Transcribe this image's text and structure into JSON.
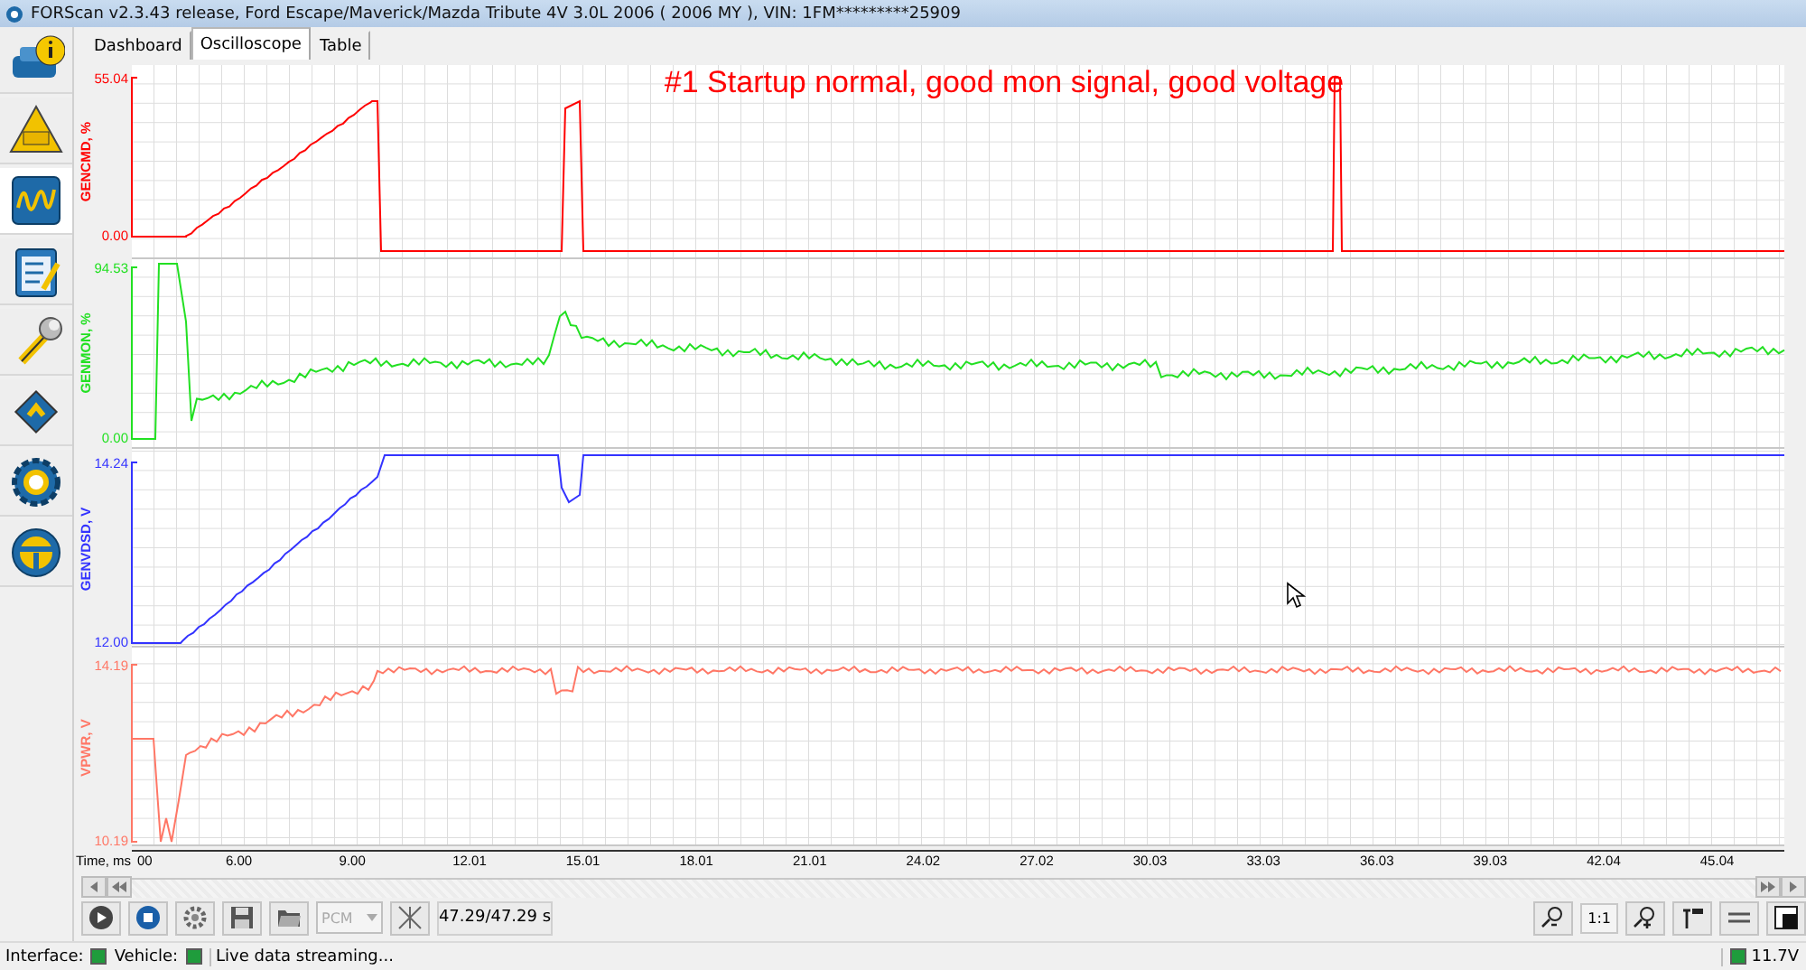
{
  "window": {
    "title": "FORScan v2.3.43 release, Ford Escape/Maverick/Mazda Tribute 4V 3.0L 2006 ( 2006 MY ), VIN: 1FM*********25909"
  },
  "sidebar": {
    "items": [
      {
        "selected": false
      },
      {
        "selected": false
      },
      {
        "selected": true
      },
      {
        "selected": false
      },
      {
        "selected": false
      },
      {
        "selected": false
      },
      {
        "selected": false
      },
      {
        "selected": false
      }
    ]
  },
  "tabs": [
    {
      "label": "Dashboard",
      "selected": false
    },
    {
      "label": "Oscilloscope",
      "selected": true
    },
    {
      "label": "Table",
      "selected": false
    }
  ],
  "oscilloscope": {
    "title": "#1 Startup normal, good mon signal, good voltage",
    "channels": [
      {
        "name": "GENCMD, %",
        "max": "55.04",
        "min": "0.00",
        "color": "#ff0000"
      },
      {
        "name": "GENMON, %",
        "max": "94.53",
        "min": "0.00",
        "color": "#22e022"
      },
      {
        "name": "GENVDSD, V",
        "max": "14.24",
        "min": "12.00",
        "color": "#3333ff"
      },
      {
        "name": "VPWR, V",
        "max": "14.19",
        "min": "10.19",
        "color": "#ff7766"
      }
    ],
    "time_axis": {
      "label": "Time, ms",
      "ticks": [
        "00",
        "6.00",
        "9.00",
        "12.01",
        "15.01",
        "18.01",
        "21.01",
        "24.02",
        "27.02",
        "30.03",
        "33.03",
        "36.03",
        "39.03",
        "42.04",
        "45.04"
      ]
    }
  },
  "toolbar": {
    "module": {
      "value": "PCM",
      "disabled": true
    },
    "time": "47.29/47.29 s",
    "scale": "1:1"
  },
  "status_bar": {
    "interface": "Interface:",
    "vehicle": "Vehicle:",
    "message": "Live data streaming...",
    "voltage": "11.7V"
  }
}
